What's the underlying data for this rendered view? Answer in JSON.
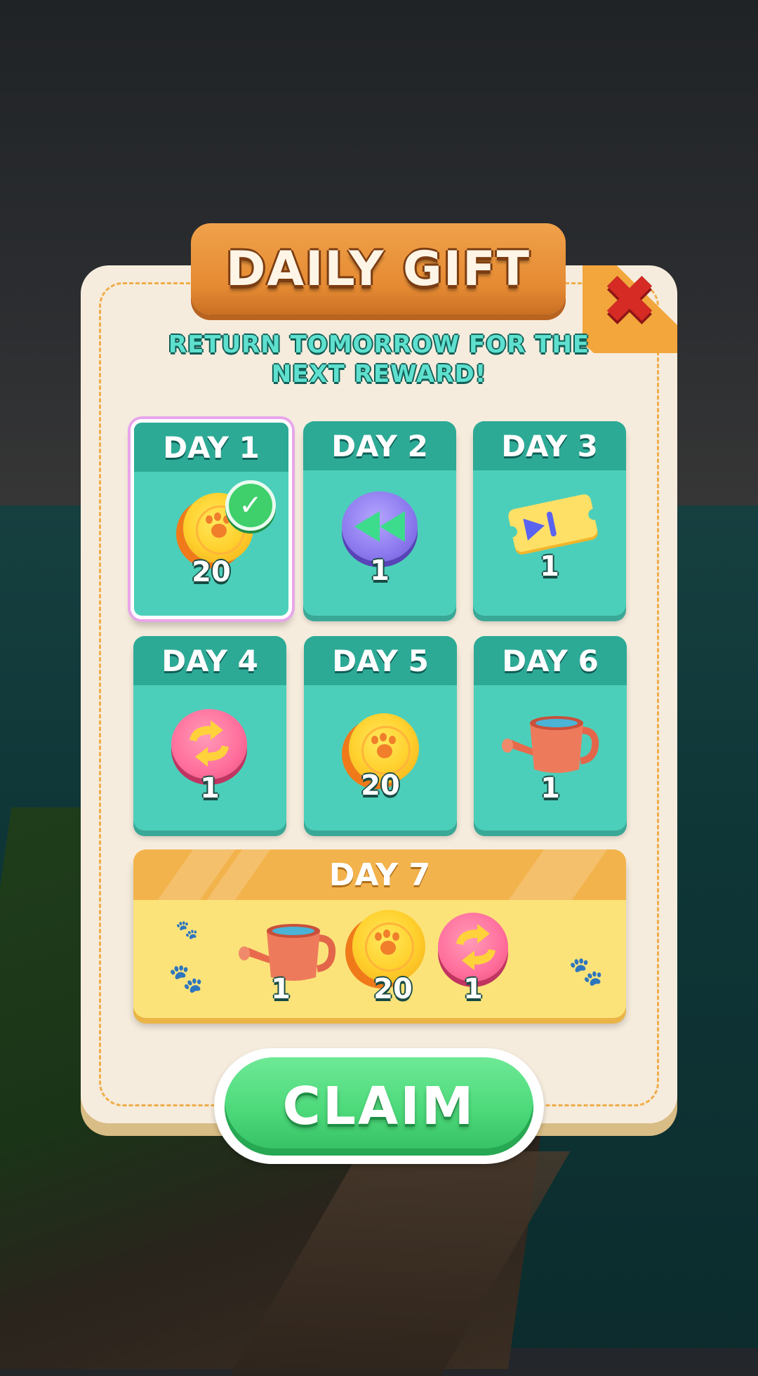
{
  "title": "DAILY GIFT",
  "subtitle_line1": "RETURN TOMORROW FOR THE",
  "subtitle_line2": "NEXT REWARD!",
  "days": [
    {
      "label": "DAY 1",
      "reward": "coin",
      "amount": "20",
      "claimed": true
    },
    {
      "label": "DAY 2",
      "reward": "rewind",
      "amount": "1"
    },
    {
      "label": "DAY 3",
      "reward": "ticket",
      "amount": "1"
    },
    {
      "label": "DAY 4",
      "reward": "swap",
      "amount": "1"
    },
    {
      "label": "DAY 5",
      "reward": "coin",
      "amount": "20"
    },
    {
      "label": "DAY 6",
      "reward": "watering-can",
      "amount": "1"
    }
  ],
  "day7": {
    "label": "DAY 7",
    "rewards": [
      {
        "reward": "watering-can",
        "amount": "1"
      },
      {
        "reward": "coin",
        "amount": "20"
      },
      {
        "reward": "swap",
        "amount": "1"
      }
    ]
  },
  "claim_label": "CLAIM",
  "colors": {
    "panel": "#f6ecdd",
    "card": "#4ccfba",
    "card_header": "#2daa96",
    "banner": "#e58a33",
    "claim": "#4cd97a",
    "close": "#d62a24"
  }
}
